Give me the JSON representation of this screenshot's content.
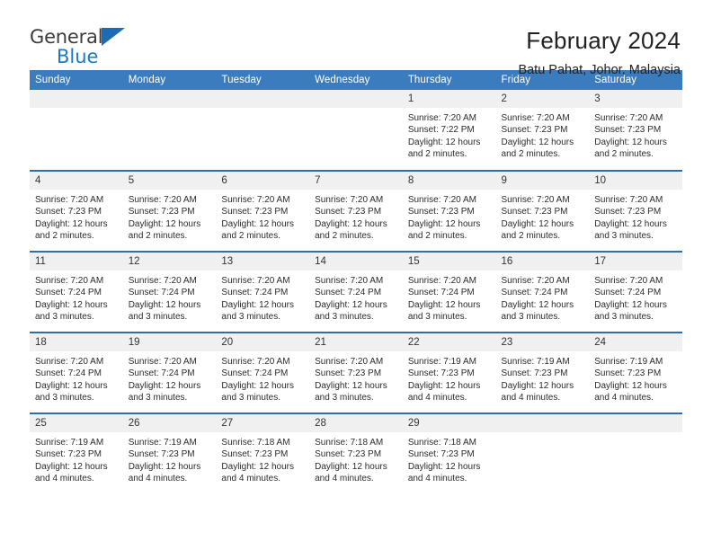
{
  "logo": {
    "word1": "General",
    "word2": "Blue",
    "triangle_color": "#1b6cb5",
    "word2_color": "#1b79c9"
  },
  "header": {
    "title": "February 2024",
    "subtitle": "Batu Pahat, Johor, Malaysia"
  },
  "theme": {
    "header_blue": "#3a7cbe",
    "row_divider_blue": "#2f6ead",
    "daynum_band": "#f0f0f0"
  },
  "weekdays": [
    "Sunday",
    "Monday",
    "Tuesday",
    "Wednesday",
    "Thursday",
    "Friday",
    "Saturday"
  ],
  "weeks": [
    [
      {
        "day": "",
        "empty": true
      },
      {
        "day": "",
        "empty": true
      },
      {
        "day": "",
        "empty": true
      },
      {
        "day": "",
        "empty": true
      },
      {
        "day": "1",
        "sunrise": "Sunrise: 7:20 AM",
        "sunset": "Sunset: 7:22 PM",
        "daylight1": "Daylight: 12 hours",
        "daylight2": "and 2 minutes."
      },
      {
        "day": "2",
        "sunrise": "Sunrise: 7:20 AM",
        "sunset": "Sunset: 7:23 PM",
        "daylight1": "Daylight: 12 hours",
        "daylight2": "and 2 minutes."
      },
      {
        "day": "3",
        "sunrise": "Sunrise: 7:20 AM",
        "sunset": "Sunset: 7:23 PM",
        "daylight1": "Daylight: 12 hours",
        "daylight2": "and 2 minutes."
      }
    ],
    [
      {
        "day": "4",
        "sunrise": "Sunrise: 7:20 AM",
        "sunset": "Sunset: 7:23 PM",
        "daylight1": "Daylight: 12 hours",
        "daylight2": "and 2 minutes."
      },
      {
        "day": "5",
        "sunrise": "Sunrise: 7:20 AM",
        "sunset": "Sunset: 7:23 PM",
        "daylight1": "Daylight: 12 hours",
        "daylight2": "and 2 minutes."
      },
      {
        "day": "6",
        "sunrise": "Sunrise: 7:20 AM",
        "sunset": "Sunset: 7:23 PM",
        "daylight1": "Daylight: 12 hours",
        "daylight2": "and 2 minutes."
      },
      {
        "day": "7",
        "sunrise": "Sunrise: 7:20 AM",
        "sunset": "Sunset: 7:23 PM",
        "daylight1": "Daylight: 12 hours",
        "daylight2": "and 2 minutes."
      },
      {
        "day": "8",
        "sunrise": "Sunrise: 7:20 AM",
        "sunset": "Sunset: 7:23 PM",
        "daylight1": "Daylight: 12 hours",
        "daylight2": "and 2 minutes."
      },
      {
        "day": "9",
        "sunrise": "Sunrise: 7:20 AM",
        "sunset": "Sunset: 7:23 PM",
        "daylight1": "Daylight: 12 hours",
        "daylight2": "and 2 minutes."
      },
      {
        "day": "10",
        "sunrise": "Sunrise: 7:20 AM",
        "sunset": "Sunset: 7:23 PM",
        "daylight1": "Daylight: 12 hours",
        "daylight2": "and 3 minutes."
      }
    ],
    [
      {
        "day": "11",
        "sunrise": "Sunrise: 7:20 AM",
        "sunset": "Sunset: 7:24 PM",
        "daylight1": "Daylight: 12 hours",
        "daylight2": "and 3 minutes."
      },
      {
        "day": "12",
        "sunrise": "Sunrise: 7:20 AM",
        "sunset": "Sunset: 7:24 PM",
        "daylight1": "Daylight: 12 hours",
        "daylight2": "and 3 minutes."
      },
      {
        "day": "13",
        "sunrise": "Sunrise: 7:20 AM",
        "sunset": "Sunset: 7:24 PM",
        "daylight1": "Daylight: 12 hours",
        "daylight2": "and 3 minutes."
      },
      {
        "day": "14",
        "sunrise": "Sunrise: 7:20 AM",
        "sunset": "Sunset: 7:24 PM",
        "daylight1": "Daylight: 12 hours",
        "daylight2": "and 3 minutes."
      },
      {
        "day": "15",
        "sunrise": "Sunrise: 7:20 AM",
        "sunset": "Sunset: 7:24 PM",
        "daylight1": "Daylight: 12 hours",
        "daylight2": "and 3 minutes."
      },
      {
        "day": "16",
        "sunrise": "Sunrise: 7:20 AM",
        "sunset": "Sunset: 7:24 PM",
        "daylight1": "Daylight: 12 hours",
        "daylight2": "and 3 minutes."
      },
      {
        "day": "17",
        "sunrise": "Sunrise: 7:20 AM",
        "sunset": "Sunset: 7:24 PM",
        "daylight1": "Daylight: 12 hours",
        "daylight2": "and 3 minutes."
      }
    ],
    [
      {
        "day": "18",
        "sunrise": "Sunrise: 7:20 AM",
        "sunset": "Sunset: 7:24 PM",
        "daylight1": "Daylight: 12 hours",
        "daylight2": "and 3 minutes."
      },
      {
        "day": "19",
        "sunrise": "Sunrise: 7:20 AM",
        "sunset": "Sunset: 7:24 PM",
        "daylight1": "Daylight: 12 hours",
        "daylight2": "and 3 minutes."
      },
      {
        "day": "20",
        "sunrise": "Sunrise: 7:20 AM",
        "sunset": "Sunset: 7:24 PM",
        "daylight1": "Daylight: 12 hours",
        "daylight2": "and 3 minutes."
      },
      {
        "day": "21",
        "sunrise": "Sunrise: 7:20 AM",
        "sunset": "Sunset: 7:23 PM",
        "daylight1": "Daylight: 12 hours",
        "daylight2": "and 3 minutes."
      },
      {
        "day": "22",
        "sunrise": "Sunrise: 7:19 AM",
        "sunset": "Sunset: 7:23 PM",
        "daylight1": "Daylight: 12 hours",
        "daylight2": "and 4 minutes."
      },
      {
        "day": "23",
        "sunrise": "Sunrise: 7:19 AM",
        "sunset": "Sunset: 7:23 PM",
        "daylight1": "Daylight: 12 hours",
        "daylight2": "and 4 minutes."
      },
      {
        "day": "24",
        "sunrise": "Sunrise: 7:19 AM",
        "sunset": "Sunset: 7:23 PM",
        "daylight1": "Daylight: 12 hours",
        "daylight2": "and 4 minutes."
      }
    ],
    [
      {
        "day": "25",
        "sunrise": "Sunrise: 7:19 AM",
        "sunset": "Sunset: 7:23 PM",
        "daylight1": "Daylight: 12 hours",
        "daylight2": "and 4 minutes."
      },
      {
        "day": "26",
        "sunrise": "Sunrise: 7:19 AM",
        "sunset": "Sunset: 7:23 PM",
        "daylight1": "Daylight: 12 hours",
        "daylight2": "and 4 minutes."
      },
      {
        "day": "27",
        "sunrise": "Sunrise: 7:18 AM",
        "sunset": "Sunset: 7:23 PM",
        "daylight1": "Daylight: 12 hours",
        "daylight2": "and 4 minutes."
      },
      {
        "day": "28",
        "sunrise": "Sunrise: 7:18 AM",
        "sunset": "Sunset: 7:23 PM",
        "daylight1": "Daylight: 12 hours",
        "daylight2": "and 4 minutes."
      },
      {
        "day": "29",
        "sunrise": "Sunrise: 7:18 AM",
        "sunset": "Sunset: 7:23 PM",
        "daylight1": "Daylight: 12 hours",
        "daylight2": "and 4 minutes."
      },
      {
        "day": "",
        "empty": true
      },
      {
        "day": "",
        "empty": true
      }
    ]
  ]
}
